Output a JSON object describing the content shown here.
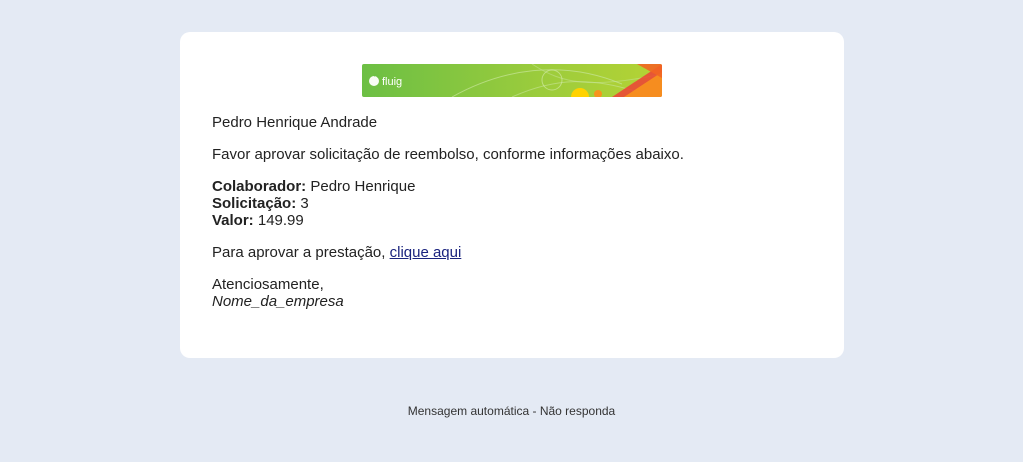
{
  "banner": {
    "logo_text": "fluig",
    "icon": "fluig-logo-icon",
    "colors": {
      "green_start": "#7cc242",
      "green_end": "#a6ce39",
      "accent_orange": "#f7941d",
      "accent_red": "#ef4136",
      "accent_yellow": "#ffd200"
    }
  },
  "email": {
    "recipient_name": "Pedro Henrique Andrade",
    "intro": "Favor aprovar solicitação de reembolso, conforme informações abaixo.",
    "fields": {
      "colaborador_label": "Colaborador:",
      "colaborador_value": "Pedro Henrique",
      "solicitacao_label": "Solicitação:",
      "solicitacao_value": "3",
      "valor_label": "Valor:",
      "valor_value": "149.99"
    },
    "approve_prefix": "Para aprovar a prestação,",
    "approve_link": "clique aqui",
    "closing": "Atenciosamente,",
    "company": "Nome_da_empresa",
    "link_color": "#1a237e"
  },
  "footer": {
    "text": "Mensagem automática - Não responda"
  }
}
